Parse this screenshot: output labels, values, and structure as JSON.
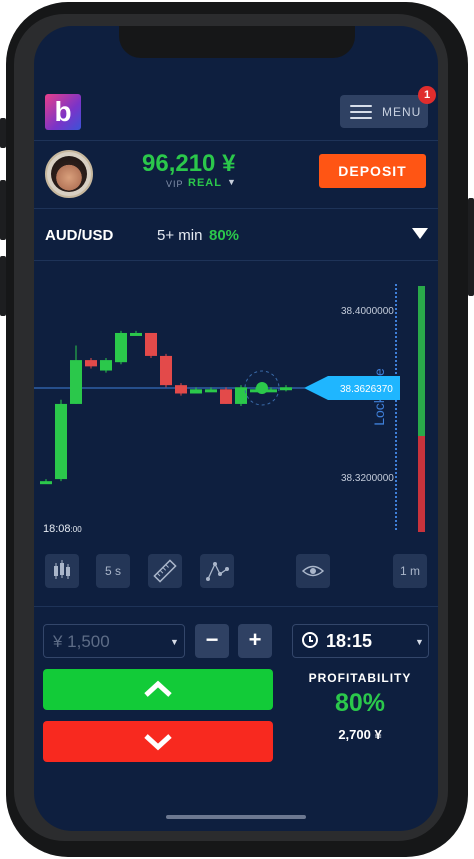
{
  "header": {
    "logo_letter": "b",
    "menu_label": "MENU",
    "notification_count": "1"
  },
  "account": {
    "balance": "96,210 ¥",
    "vip_label": "VIP",
    "account_type": "REAL",
    "deposit_label": "DEPOSIT"
  },
  "asset": {
    "pair": "AUD/USD",
    "duration": "5+ min",
    "payout": "80%"
  },
  "chart": {
    "price_top": "38.4000000",
    "price_current": "38.3626370",
    "price_bottom": "38.3200000",
    "time_label": "18:08",
    "time_label_sec": ":00",
    "lock_label": "Lock rate",
    "colors": {
      "up": "#2bc84b",
      "down": "#e34a4a",
      "marker": "#1fb6ff"
    }
  },
  "chart_data": {
    "type": "candlestick",
    "title": "",
    "y_ticks": [
      "38.4000000",
      "38.3200000"
    ],
    "current_price": 38.362637,
    "x_label": "18:08:00",
    "candles": [
      {
        "open": 38.318,
        "close": 38.318,
        "high": 38.319,
        "low": 38.317
      },
      {
        "open": 38.319,
        "close": 38.355,
        "high": 38.357,
        "low": 38.318
      },
      {
        "open": 38.355,
        "close": 38.376,
        "high": 38.383,
        "low": 38.355
      },
      {
        "open": 38.376,
        "close": 38.373,
        "high": 38.377,
        "low": 38.372
      },
      {
        "open": 38.371,
        "close": 38.376,
        "high": 38.377,
        "low": 38.37
      },
      {
        "open": 38.375,
        "close": 38.389,
        "high": 38.39,
        "low": 38.374
      },
      {
        "open": 38.389,
        "close": 38.389,
        "high": 38.39,
        "low": 38.388
      },
      {
        "open": 38.389,
        "close": 38.378,
        "high": 38.389,
        "low": 38.377
      },
      {
        "open": 38.378,
        "close": 38.364,
        "high": 38.379,
        "low": 38.363
      },
      {
        "open": 38.364,
        "close": 38.36,
        "high": 38.365,
        "low": 38.359
      },
      {
        "open": 38.36,
        "close": 38.362,
        "high": 38.363,
        "low": 38.36
      },
      {
        "open": 38.362,
        "close": 38.362,
        "high": 38.363,
        "low": 38.361
      },
      {
        "open": 38.362,
        "close": 38.355,
        "high": 38.363,
        "low": 38.355
      },
      {
        "open": 38.355,
        "close": 38.363,
        "high": 38.364,
        "low": 38.354
      },
      {
        "open": 38.362,
        "close": 38.362,
        "high": 38.363,
        "low": 38.361
      },
      {
        "open": 38.362,
        "close": 38.362,
        "high": 38.363,
        "low": 38.361
      },
      {
        "open": 38.362,
        "close": 38.363,
        "high": 38.364,
        "low": 38.361
      }
    ]
  },
  "toolbar": {
    "timeframe": "5 s",
    "interval": "1 m"
  },
  "trade": {
    "amount": "¥ 1,500",
    "minus": "−",
    "plus": "+",
    "expiry_time": "18:15",
    "profitability_label": "PROFITABILITY",
    "profitability_pct": "80%",
    "profitability_amount": "2,700 ¥",
    "up_icon": "chevron-up-icon",
    "down_icon": "chevron-down-icon"
  }
}
